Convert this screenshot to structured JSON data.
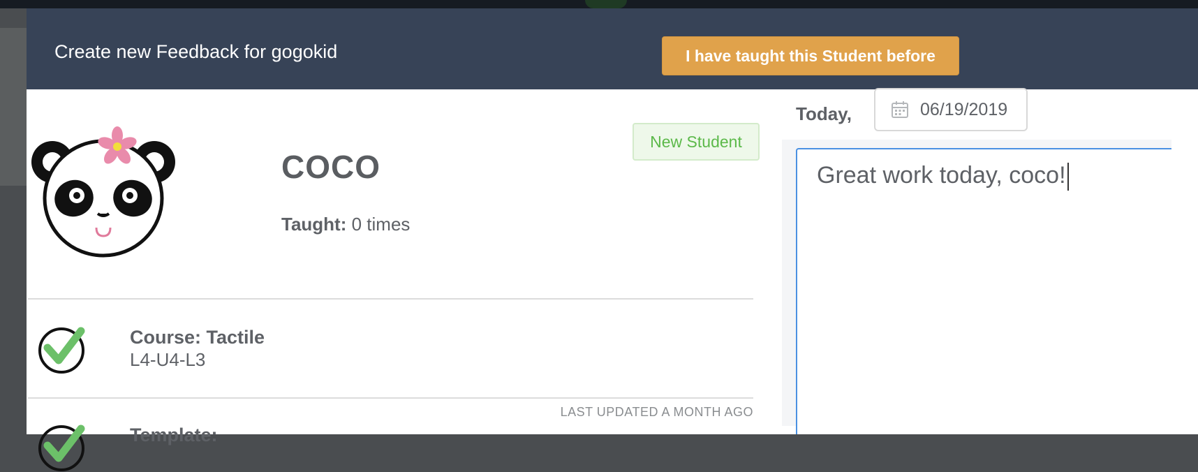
{
  "modal": {
    "title": "Create new Feedback for gogokid",
    "taught_before_button": "I have taught this Student before"
  },
  "student": {
    "name": "COCO",
    "taught_label": "Taught:",
    "taught_value": "0 times",
    "badge": "New Student",
    "avatar_icon": "panda-avatar-icon"
  },
  "course": {
    "title": "Course: Tactile",
    "code": "L4-U4-L3",
    "status_icon": "check-circle-icon"
  },
  "template": {
    "last_updated": "LAST UPDATED A MONTH AGO",
    "title": "Template:",
    "status_icon": "check-circle-icon"
  },
  "feedback": {
    "date_label": "Today,",
    "date_value": "06/19/2019",
    "date_icon": "calendar-icon",
    "text": "Great work today, coco!"
  },
  "colors": {
    "header_bg": "#374357",
    "accent_button": "#e0a24b",
    "badge_green": "#5cb94a",
    "check_green": "#6cc069",
    "focus_blue": "#4a90e2"
  }
}
